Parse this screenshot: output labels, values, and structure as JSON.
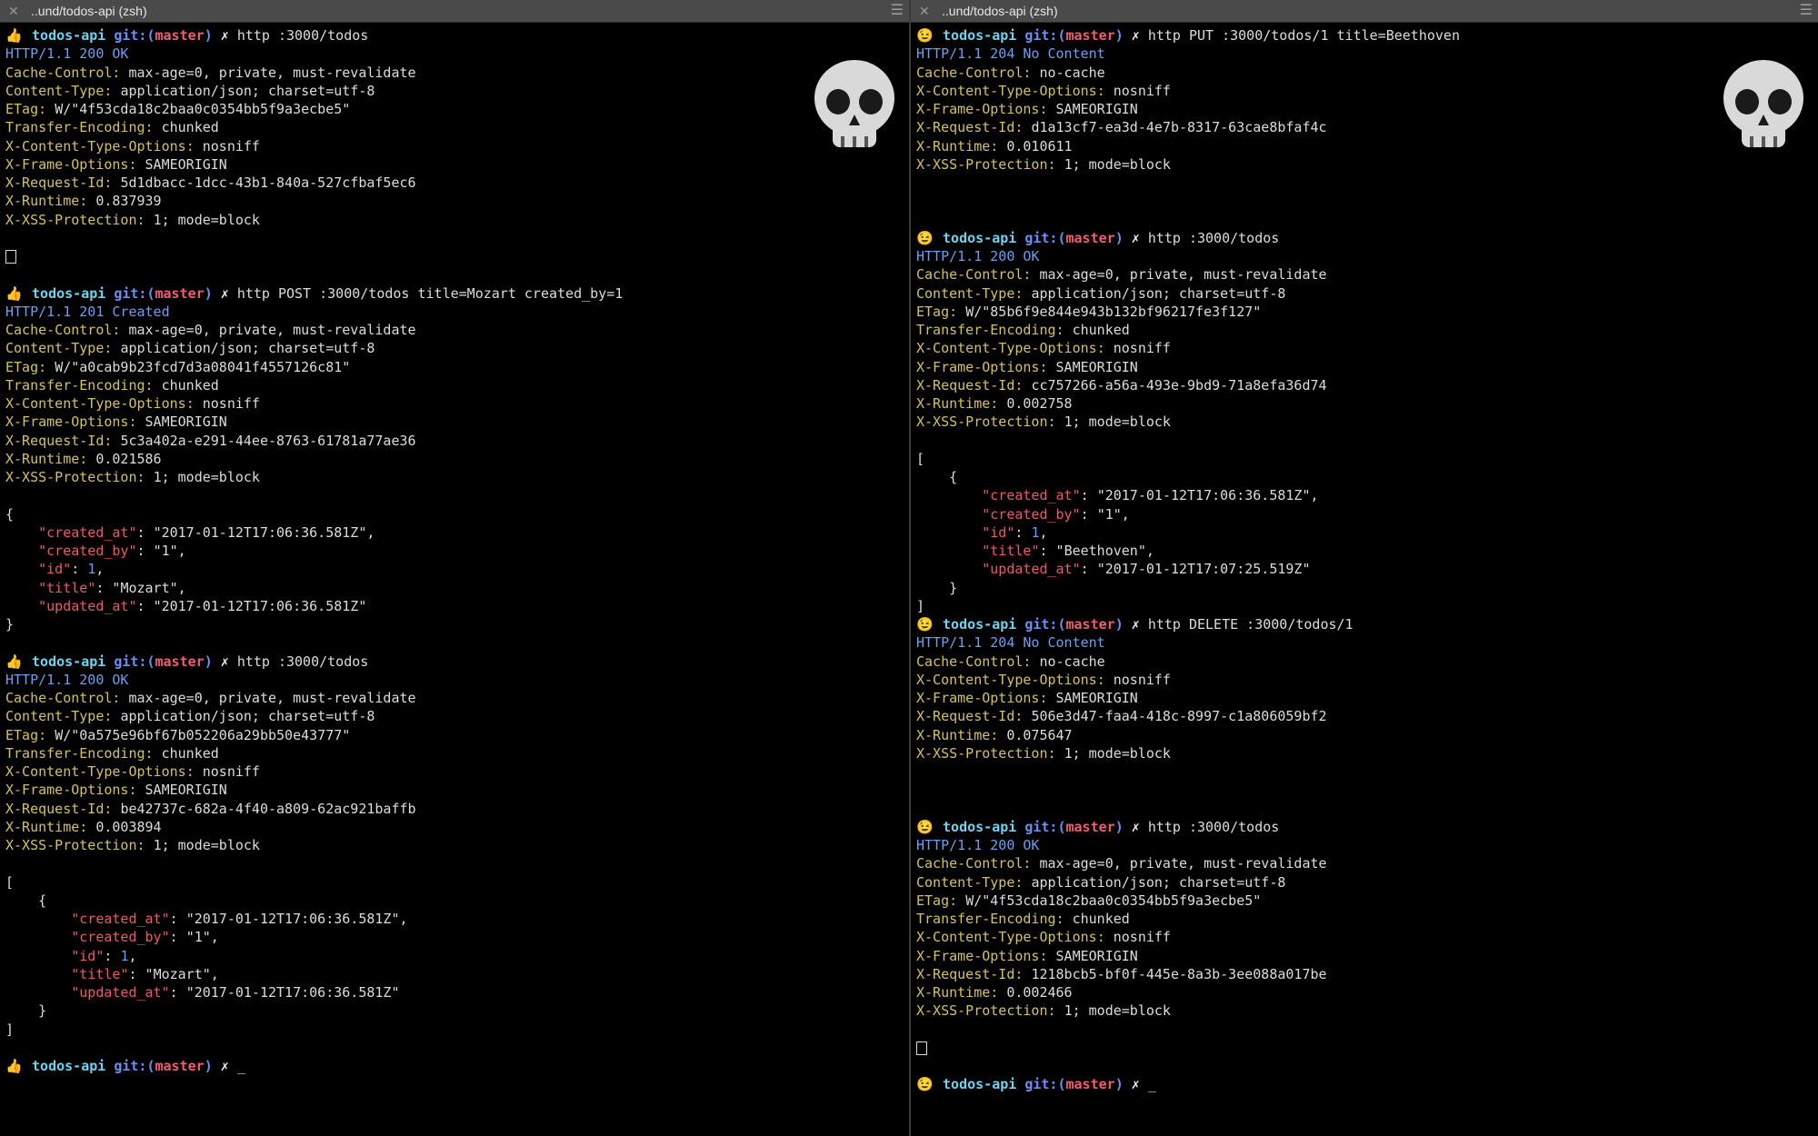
{
  "panes": [
    {
      "title": "..und/todos-api (zsh)",
      "prompt_emoji": "👍",
      "lines": [
        {
          "t": "prompt",
          "dir": "todos-api",
          "git": "git:(",
          "branch": "master",
          "gitEnd": ")",
          "x": "✗",
          "cmd": "http :3000/todos"
        },
        {
          "t": "status",
          "text": "HTTP/1.1 200 OK"
        },
        {
          "t": "h",
          "k": "Cache-Control",
          "v": "max-age=0, private, must-revalidate"
        },
        {
          "t": "h",
          "k": "Content-Type",
          "v": "application/json; charset=utf-8"
        },
        {
          "t": "h",
          "k": "ETag",
          "v": "W/\"4f53cda18c2baa0c0354bb5f9a3ecbe5\""
        },
        {
          "t": "h",
          "k": "Transfer-Encoding",
          "v": "chunked"
        },
        {
          "t": "h",
          "k": "X-Content-Type-Options",
          "v": "nosniff"
        },
        {
          "t": "h",
          "k": "X-Frame-Options",
          "v": "SAMEORIGIN"
        },
        {
          "t": "h",
          "k": "X-Request-Id",
          "v": "5d1dbacc-1dcc-43b1-840a-527cfbaf5ec6"
        },
        {
          "t": "h",
          "k": "X-Runtime",
          "v": "0.837939"
        },
        {
          "t": "h",
          "k": "X-XSS-Protection",
          "v": "1; mode=block"
        },
        {
          "t": "blank"
        },
        {
          "t": "box"
        },
        {
          "t": "blank"
        },
        {
          "t": "prompt",
          "dir": "todos-api",
          "git": "git:(",
          "branch": "master",
          "gitEnd": ")",
          "x": "✗",
          "cmd": "http POST :3000/todos title=Mozart created_by=1"
        },
        {
          "t": "status",
          "text": "HTTP/1.1 201 Created"
        },
        {
          "t": "h",
          "k": "Cache-Control",
          "v": "max-age=0, private, must-revalidate"
        },
        {
          "t": "h",
          "k": "Content-Type",
          "v": "application/json; charset=utf-8"
        },
        {
          "t": "h",
          "k": "ETag",
          "v": "W/\"a0cab9b23fcd7d3a08041f4557126c81\""
        },
        {
          "t": "h",
          "k": "Transfer-Encoding",
          "v": "chunked"
        },
        {
          "t": "h",
          "k": "X-Content-Type-Options",
          "v": "nosniff"
        },
        {
          "t": "h",
          "k": "X-Frame-Options",
          "v": "SAMEORIGIN"
        },
        {
          "t": "h",
          "k": "X-Request-Id",
          "v": "5c3a402a-e291-44ee-8763-61781a77ae36"
        },
        {
          "t": "h",
          "k": "X-Runtime",
          "v": "0.021586"
        },
        {
          "t": "h",
          "k": "X-XSS-Protection",
          "v": "1; mode=block"
        },
        {
          "t": "blank"
        },
        {
          "t": "p",
          "indent": "",
          "text": "{"
        },
        {
          "t": "j",
          "indent": "    ",
          "k": "created_at",
          "v": "2017-01-12T17:06:36.581Z",
          "vt": "s",
          "comma": true
        },
        {
          "t": "j",
          "indent": "    ",
          "k": "created_by",
          "v": "1",
          "vt": "s",
          "comma": true
        },
        {
          "t": "j",
          "indent": "    ",
          "k": "id",
          "v": "1",
          "vt": "n",
          "comma": true
        },
        {
          "t": "j",
          "indent": "    ",
          "k": "title",
          "v": "Mozart",
          "vt": "s",
          "comma": true
        },
        {
          "t": "j",
          "indent": "    ",
          "k": "updated_at",
          "v": "2017-01-12T17:06:36.581Z",
          "vt": "s",
          "comma": false
        },
        {
          "t": "p",
          "indent": "",
          "text": "}"
        },
        {
          "t": "blank"
        },
        {
          "t": "prompt",
          "dir": "todos-api",
          "git": "git:(",
          "branch": "master",
          "gitEnd": ")",
          "x": "✗",
          "cmd": "http :3000/todos"
        },
        {
          "t": "status",
          "text": "HTTP/1.1 200 OK"
        },
        {
          "t": "h",
          "k": "Cache-Control",
          "v": "max-age=0, private, must-revalidate"
        },
        {
          "t": "h",
          "k": "Content-Type",
          "v": "application/json; charset=utf-8"
        },
        {
          "t": "h",
          "k": "ETag",
          "v": "W/\"0a575e96bf67b052206a29bb50e43777\""
        },
        {
          "t": "h",
          "k": "Transfer-Encoding",
          "v": "chunked"
        },
        {
          "t": "h",
          "k": "X-Content-Type-Options",
          "v": "nosniff"
        },
        {
          "t": "h",
          "k": "X-Frame-Options",
          "v": "SAMEORIGIN"
        },
        {
          "t": "h",
          "k": "X-Request-Id",
          "v": "be42737c-682a-4f40-a809-62ac921baffb"
        },
        {
          "t": "h",
          "k": "X-Runtime",
          "v": "0.003894"
        },
        {
          "t": "h",
          "k": "X-XSS-Protection",
          "v": "1; mode=block"
        },
        {
          "t": "blank"
        },
        {
          "t": "p",
          "indent": "",
          "text": "["
        },
        {
          "t": "p",
          "indent": "    ",
          "text": "{"
        },
        {
          "t": "j",
          "indent": "        ",
          "k": "created_at",
          "v": "2017-01-12T17:06:36.581Z",
          "vt": "s",
          "comma": true
        },
        {
          "t": "j",
          "indent": "        ",
          "k": "created_by",
          "v": "1",
          "vt": "s",
          "comma": true
        },
        {
          "t": "j",
          "indent": "        ",
          "k": "id",
          "v": "1",
          "vt": "n",
          "comma": true
        },
        {
          "t": "j",
          "indent": "        ",
          "k": "title",
          "v": "Mozart",
          "vt": "s",
          "comma": true
        },
        {
          "t": "j",
          "indent": "        ",
          "k": "updated_at",
          "v": "2017-01-12T17:06:36.581Z",
          "vt": "s",
          "comma": false
        },
        {
          "t": "p",
          "indent": "    ",
          "text": "}"
        },
        {
          "t": "p",
          "indent": "",
          "text": "]"
        },
        {
          "t": "blank"
        },
        {
          "t": "prompt",
          "dir": "todos-api",
          "git": "git:(",
          "branch": "master",
          "gitEnd": ")",
          "x": "✗",
          "cmd": "",
          "cursor": "_"
        }
      ]
    },
    {
      "title": "..und/todos-api (zsh)",
      "prompt_emoji": "😉",
      "lines": [
        {
          "t": "prompt",
          "dir": "todos-api",
          "git": "git:(",
          "branch": "master",
          "gitEnd": ")",
          "x": "✗",
          "cmd": "http PUT :3000/todos/1 title=Beethoven"
        },
        {
          "t": "status",
          "text": "HTTP/1.1 204 No Content"
        },
        {
          "t": "h",
          "k": "Cache-Control",
          "v": "no-cache"
        },
        {
          "t": "h",
          "k": "X-Content-Type-Options",
          "v": "nosniff"
        },
        {
          "t": "h",
          "k": "X-Frame-Options",
          "v": "SAMEORIGIN"
        },
        {
          "t": "h",
          "k": "X-Request-Id",
          "v": "d1a13cf7-ea3d-4e7b-8317-63cae8bfaf4c"
        },
        {
          "t": "h",
          "k": "X-Runtime",
          "v": "0.010611"
        },
        {
          "t": "h",
          "k": "X-XSS-Protection",
          "v": "1; mode=block"
        },
        {
          "t": "blank"
        },
        {
          "t": "blank"
        },
        {
          "t": "blank"
        },
        {
          "t": "prompt",
          "dir": "todos-api",
          "git": "git:(",
          "branch": "master",
          "gitEnd": ")",
          "x": "✗",
          "cmd": "http :3000/todos"
        },
        {
          "t": "status",
          "text": "HTTP/1.1 200 OK"
        },
        {
          "t": "h",
          "k": "Cache-Control",
          "v": "max-age=0, private, must-revalidate"
        },
        {
          "t": "h",
          "k": "Content-Type",
          "v": "application/json; charset=utf-8"
        },
        {
          "t": "h",
          "k": "ETag",
          "v": "W/\"85b6f9e844e943b132bf96217fe3f127\""
        },
        {
          "t": "h",
          "k": "Transfer-Encoding",
          "v": "chunked"
        },
        {
          "t": "h",
          "k": "X-Content-Type-Options",
          "v": "nosniff"
        },
        {
          "t": "h",
          "k": "X-Frame-Options",
          "v": "SAMEORIGIN"
        },
        {
          "t": "h",
          "k": "X-Request-Id",
          "v": "cc757266-a56a-493e-9bd9-71a8efa36d74"
        },
        {
          "t": "h",
          "k": "X-Runtime",
          "v": "0.002758"
        },
        {
          "t": "h",
          "k": "X-XSS-Protection",
          "v": "1; mode=block"
        },
        {
          "t": "blank"
        },
        {
          "t": "p",
          "indent": "",
          "text": "["
        },
        {
          "t": "p",
          "indent": "    ",
          "text": "{"
        },
        {
          "t": "j",
          "indent": "        ",
          "k": "created_at",
          "v": "2017-01-12T17:06:36.581Z",
          "vt": "s",
          "comma": true
        },
        {
          "t": "j",
          "indent": "        ",
          "k": "created_by",
          "v": "1",
          "vt": "s",
          "comma": true
        },
        {
          "t": "j",
          "indent": "        ",
          "k": "id",
          "v": "1",
          "vt": "n",
          "comma": true
        },
        {
          "t": "j",
          "indent": "        ",
          "k": "title",
          "v": "Beethoven",
          "vt": "s",
          "comma": true
        },
        {
          "t": "j",
          "indent": "        ",
          "k": "updated_at",
          "v": "2017-01-12T17:07:25.519Z",
          "vt": "s",
          "comma": false
        },
        {
          "t": "p",
          "indent": "    ",
          "text": "}"
        },
        {
          "t": "p",
          "indent": "",
          "text": "]"
        },
        {
          "t": "prompt",
          "dir": "todos-api",
          "git": "git:(",
          "branch": "master",
          "gitEnd": ")",
          "x": "✗",
          "cmd": "http DELETE :3000/todos/1"
        },
        {
          "t": "status",
          "text": "HTTP/1.1 204 No Content"
        },
        {
          "t": "h",
          "k": "Cache-Control",
          "v": "no-cache"
        },
        {
          "t": "h",
          "k": "X-Content-Type-Options",
          "v": "nosniff"
        },
        {
          "t": "h",
          "k": "X-Frame-Options",
          "v": "SAMEORIGIN"
        },
        {
          "t": "h",
          "k": "X-Request-Id",
          "v": "506e3d47-faa4-418c-8997-c1a806059bf2"
        },
        {
          "t": "h",
          "k": "X-Runtime",
          "v": "0.075647"
        },
        {
          "t": "h",
          "k": "X-XSS-Protection",
          "v": "1; mode=block"
        },
        {
          "t": "blank"
        },
        {
          "t": "blank"
        },
        {
          "t": "blank"
        },
        {
          "t": "prompt",
          "dir": "todos-api",
          "git": "git:(",
          "branch": "master",
          "gitEnd": ")",
          "x": "✗",
          "cmd": "http :3000/todos"
        },
        {
          "t": "status",
          "text": "HTTP/1.1 200 OK"
        },
        {
          "t": "h",
          "k": "Cache-Control",
          "v": "max-age=0, private, must-revalidate"
        },
        {
          "t": "h",
          "k": "Content-Type",
          "v": "application/json; charset=utf-8"
        },
        {
          "t": "h",
          "k": "ETag",
          "v": "W/\"4f53cda18c2baa0c0354bb5f9a3ecbe5\""
        },
        {
          "t": "h",
          "k": "Transfer-Encoding",
          "v": "chunked"
        },
        {
          "t": "h",
          "k": "X-Content-Type-Options",
          "v": "nosniff"
        },
        {
          "t": "h",
          "k": "X-Frame-Options",
          "v": "SAMEORIGIN"
        },
        {
          "t": "h",
          "k": "X-Request-Id",
          "v": "1218bcb5-bf0f-445e-8a3b-3ee088a017be"
        },
        {
          "t": "h",
          "k": "X-Runtime",
          "v": "0.002466"
        },
        {
          "t": "h",
          "k": "X-XSS-Protection",
          "v": "1; mode=block"
        },
        {
          "t": "blank"
        },
        {
          "t": "box"
        },
        {
          "t": "blank"
        },
        {
          "t": "prompt",
          "dir": "todos-api",
          "git": "git:(",
          "branch": "master",
          "gitEnd": ")",
          "x": "✗",
          "cmd": "",
          "cursor": "_"
        }
      ]
    }
  ]
}
